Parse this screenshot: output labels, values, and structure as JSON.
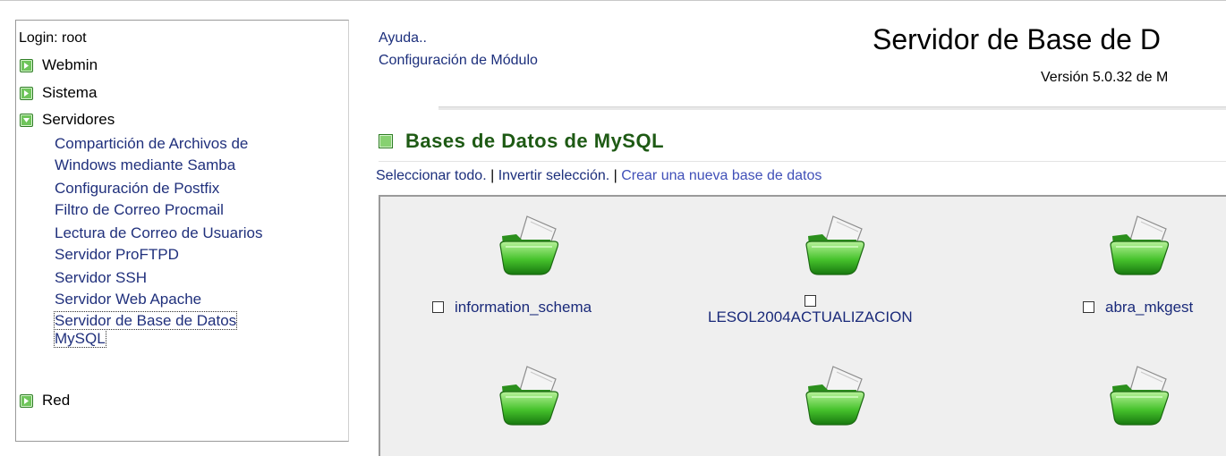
{
  "sidebar": {
    "login": "Login: root",
    "categories": [
      {
        "label": "Webmin",
        "expanded": false
      },
      {
        "label": "Sistema",
        "expanded": false
      },
      {
        "label": "Servidores",
        "expanded": true
      },
      {
        "label": "Red",
        "expanded": false
      }
    ],
    "items": [
      "Compartición de Archivos de",
      "Windows mediante Samba",
      "Configuración de Postfix",
      "Filtro de Correo Procmail",
      "Lectura de Correo de Usuarios",
      "Servidor ProFTPD",
      "Servidor SSH",
      "Servidor Web Apache",
      "Servidor de Base de Datos",
      "MySQL"
    ]
  },
  "header": {
    "help": "Ayuda..",
    "module_config": "Configuración de Módulo",
    "title": "Servidor de Base de D",
    "version": "Versión 5.0.32 de M"
  },
  "section": {
    "title": "Bases de Datos de MySQL",
    "select_all": "Seleccionar todo.",
    "sep": " | ",
    "invert": "Invertir selección.",
    "create": "Crear una nueva base de datos"
  },
  "databases": [
    {
      "name": "information_schema",
      "checked": false
    },
    {
      "name": "LESOL2004ACTUALIZACION",
      "checked": false
    },
    {
      "name": "abra_mkgest",
      "checked": false
    }
  ],
  "colors": {
    "link": "#1c2f7c",
    "section_title": "#1e5a14",
    "panel_bg": "#efefef"
  }
}
